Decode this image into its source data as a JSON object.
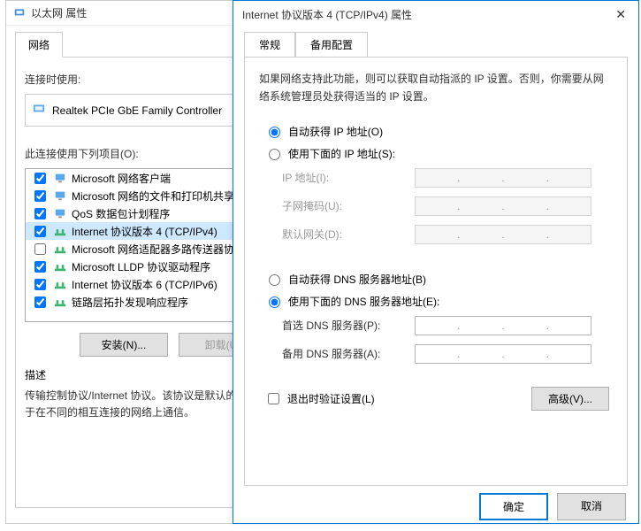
{
  "back": {
    "title": "以太网 属性",
    "tab_network": "网络",
    "connect_label": "连接时使用:",
    "adapter": "Realtek PCIe GbE Family Controller",
    "items_label": "此连接使用下列项目(O):",
    "items": [
      {
        "checked": true,
        "icon": "client",
        "label": "Microsoft 网络客户端"
      },
      {
        "checked": true,
        "icon": "client",
        "label": "Microsoft 网络的文件和打印机共享"
      },
      {
        "checked": true,
        "icon": "client",
        "label": "QoS 数据包计划程序"
      },
      {
        "checked": true,
        "icon": "proto",
        "label": "Internet 协议版本 4 (TCP/IPv4)",
        "selected": true
      },
      {
        "checked": false,
        "icon": "proto",
        "label": "Microsoft 网络适配器多路传送器协议"
      },
      {
        "checked": true,
        "icon": "proto",
        "label": "Microsoft LLDP 协议驱动程序"
      },
      {
        "checked": true,
        "icon": "proto",
        "label": "Internet 协议版本 6 (TCP/IPv6)"
      },
      {
        "checked": true,
        "icon": "proto",
        "label": "链路层拓扑发现响应程序"
      }
    ],
    "install_btn": "安装(N)...",
    "uninstall_btn": "卸载(U)",
    "desc_title": "描述",
    "desc_text": "传输控制协议/Internet 协议。该协议是默认的广域网络协议，用于在不同的相互连接的网络上通信。"
  },
  "front": {
    "title": "Internet 协议版本 4 (TCP/IPv4) 属性",
    "tab_general": "常规",
    "tab_alt": "备用配置",
    "intro": "如果网络支持此功能，则可以获取自动指派的 IP 设置。否则，你需要从网络系统管理员处获得适当的 IP 设置。",
    "auto_ip": "自动获得 IP 地址(O)",
    "manual_ip": "使用下面的 IP 地址(S):",
    "ip_addr": "IP 地址(I):",
    "subnet": "子网掩码(U):",
    "gateway": "默认网关(D):",
    "auto_dns": "自动获得 DNS 服务器地址(B)",
    "manual_dns": "使用下面的 DNS 服务器地址(E):",
    "dns1": "首选 DNS 服务器(P):",
    "dns2": "备用 DNS 服务器(A):",
    "exit_validate": "退出时验证设置(L)",
    "advanced": "高级(V)...",
    "ok": "确定",
    "cancel": "取消"
  }
}
